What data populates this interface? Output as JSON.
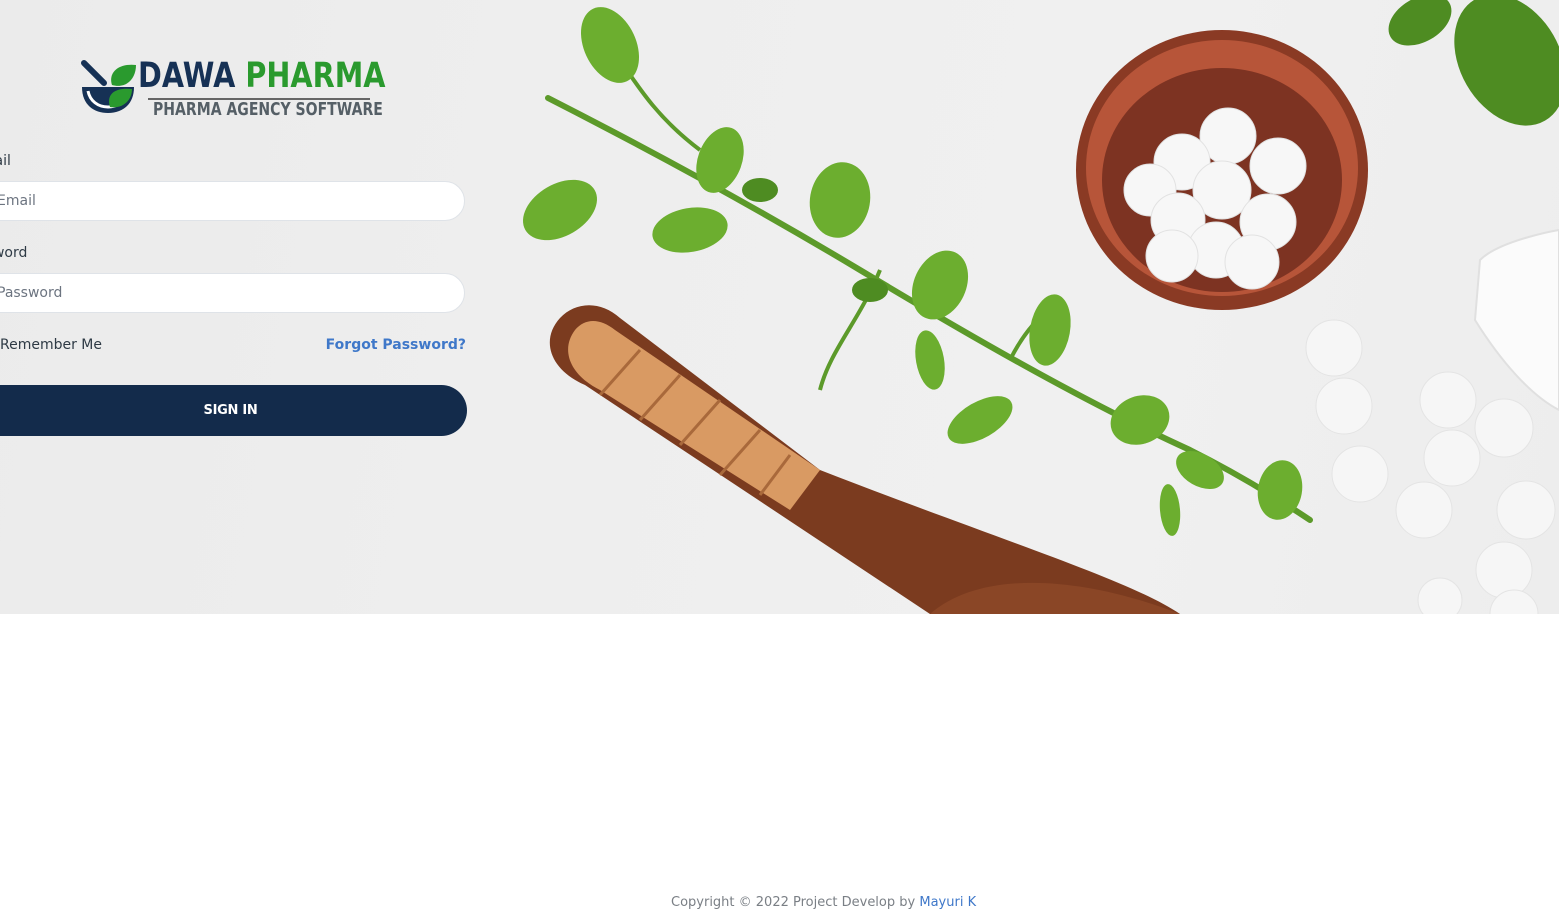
{
  "brand": {
    "name_part1": "DAWA",
    "name_part2": "PHARMA",
    "tagline": "PHARMA AGENCY SOFTWARE",
    "logo_icon": "mortar-pestle-leaf-icon",
    "colors": {
      "navy": "#163155",
      "green": "#2a9a2e"
    }
  },
  "form": {
    "email_label": "Email",
    "email_placeholder": "Email",
    "email_value": "",
    "password_label": "Password",
    "password_placeholder": "Password",
    "password_value": "",
    "remember_label": "Remember Me",
    "forgot_label": "Forgot Password?",
    "signin_label": "SIGN IN"
  },
  "footer": {
    "text": "Copyright © 2022 Project Develop by",
    "author": "Mayuri K"
  },
  "theme": {
    "primary": "#132b4b",
    "link": "#3f78c9"
  }
}
